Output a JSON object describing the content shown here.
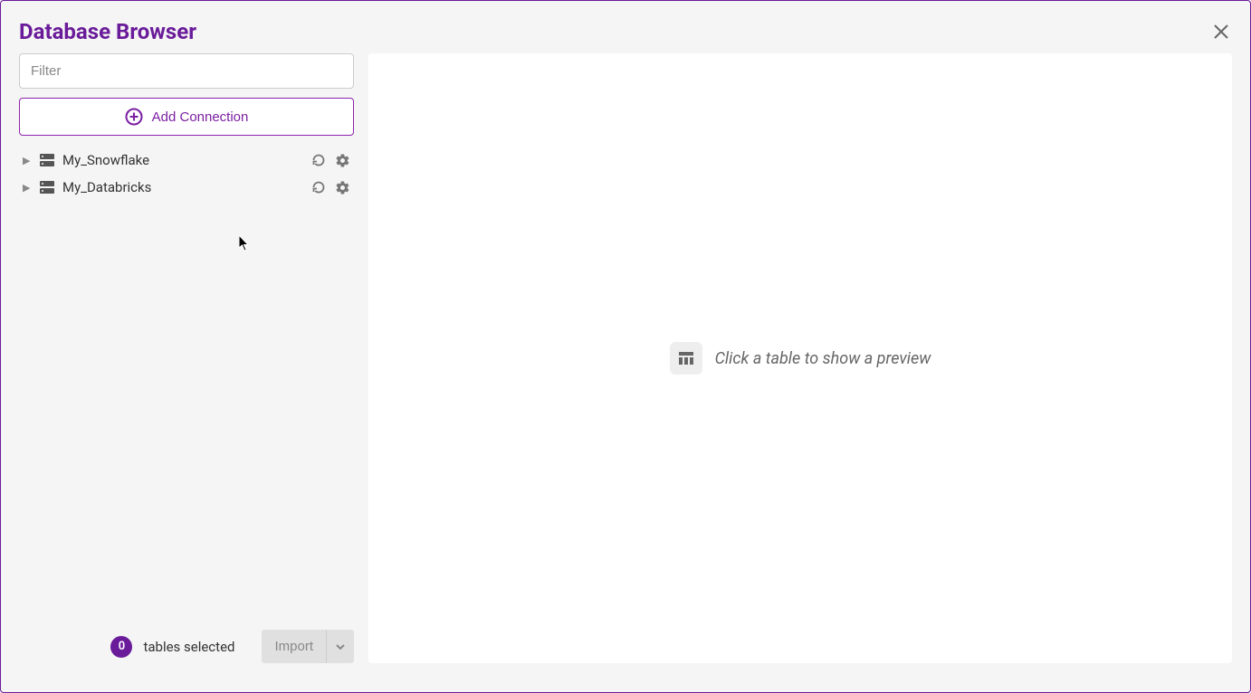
{
  "header": {
    "title": "Database Browser"
  },
  "sidebar": {
    "filter_placeholder": "Filter",
    "add_connection_label": "Add Connection",
    "connections": [
      {
        "label": "My_Snowflake"
      },
      {
        "label": "My_Databricks"
      }
    ],
    "footer": {
      "selected_count": "0",
      "selected_label": "tables selected",
      "import_label": "Import"
    }
  },
  "main": {
    "empty_text": "Click a table to show a preview"
  }
}
